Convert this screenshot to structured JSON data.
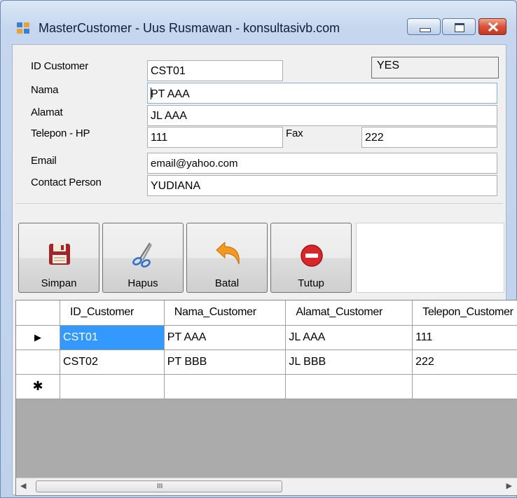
{
  "window": {
    "title": "MasterCustomer - Uus Rusmawan - konsultasivb.com"
  },
  "form": {
    "id_label": "ID Customer",
    "id_value": "CST01",
    "status_value": "YES",
    "nama_label": "Nama",
    "nama_value": "PT AAA",
    "alamat_label": "Alamat",
    "alamat_value": "JL AAA",
    "telepon_label": "Telepon - HP",
    "telepon_value": "111",
    "fax_label": "Fax",
    "fax_value": "222",
    "email_label": "Email",
    "email_value": "email@yahoo.com",
    "contact_label": "Contact Person",
    "contact_value": "YUDIANA"
  },
  "toolbar": {
    "simpan": "Simpan",
    "hapus": "Hapus",
    "batal": "Batal",
    "tutup": "Tutup"
  },
  "grid": {
    "columns": [
      "ID_Customer",
      "Nama_Customer",
      "Alamat_Customer",
      "Telepon_Customer"
    ],
    "rows": [
      [
        "CST01",
        "PT AAA",
        "JL AAA",
        "111"
      ],
      [
        "CST02",
        "PT BBB",
        "JL BBB",
        "222"
      ]
    ],
    "current_row_marker": "▶",
    "new_row_marker": "✱",
    "scroll_grip": "III"
  },
  "icons": {
    "app": "form-icon",
    "save": "floppy-icon",
    "delete": "scissors-icon",
    "cancel": "undo-arrow-icon",
    "close": "stop-icon"
  }
}
